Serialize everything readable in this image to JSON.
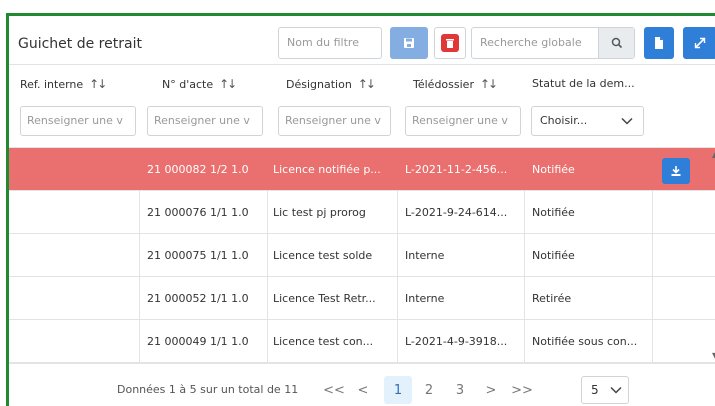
{
  "panel": {
    "title": "Guichet de retrait"
  },
  "toolbar": {
    "filter_name_placeholder": "Nom du filtre",
    "global_search_placeholder": "Recherche globale"
  },
  "columns": [
    {
      "label": "Ref. interne",
      "filter_placeholder": "Renseigner une v"
    },
    {
      "label": "N° d'acte",
      "filter_placeholder": "Renseigner une v"
    },
    {
      "label": "Désignation",
      "filter_placeholder": "Renseigner une v"
    },
    {
      "label": "Télédossier",
      "filter_placeholder": "Renseigner une v"
    },
    {
      "label": "Statut de la dem...",
      "filter_value": "Choisir..."
    }
  ],
  "rows": [
    {
      "ref": "",
      "acte": "21 000082 1/2 1.0",
      "designation": "Licence notifiée p...",
      "teledossier": "L-2021-11-2-456...",
      "statut": "Notifiée",
      "selected": true
    },
    {
      "ref": "",
      "acte": "21 000076 1/1 1.0",
      "designation": "Lic test pj prorog",
      "teledossier": "L-2021-9-24-614...",
      "statut": "Notifiée"
    },
    {
      "ref": "",
      "acte": "21 000075 1/1 1.0",
      "designation": "Licence test solde",
      "teledossier": "Interne",
      "statut": "Notifiée"
    },
    {
      "ref": "",
      "acte": "21 000052 1/1 1.0",
      "designation": "Licence Test Retr...",
      "teledossier": "Interne",
      "statut": "Retirée"
    },
    {
      "ref": "",
      "acte": "21 000049 1/1 1.0",
      "designation": "Licence test con...",
      "teledossier": "L-2021-4-9-3918...",
      "statut": "Notifiée sous con..."
    }
  ],
  "pagination": {
    "info": "Données 1 à 5 sur un total de 11",
    "first": "<<",
    "prev": "<",
    "pages": [
      "1",
      "2",
      "3"
    ],
    "next": ">",
    "last": ">>",
    "rows_per_page": "5"
  },
  "colors": {
    "border_green": "#1f8a2f",
    "selected_row": "#ea6f6f",
    "primary_blue": "#2f7ed8",
    "light_blue": "#84aee2",
    "danger_red": "#e03838"
  }
}
